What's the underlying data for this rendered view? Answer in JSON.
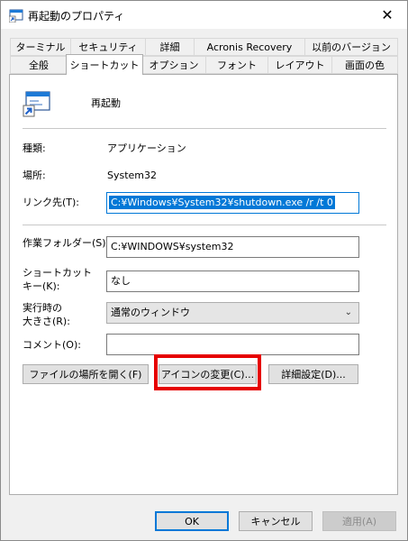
{
  "window": {
    "title": "再起動のプロパティ",
    "close_glyph": "✕"
  },
  "tabs": {
    "row1": [
      "ターミナル",
      "セキュリティ",
      "詳細",
      "Acronis Recovery",
      "以前のバージョン"
    ],
    "row2": [
      "全般",
      "ショートカット",
      "オプション",
      "フォント",
      "レイアウト",
      "画面の色"
    ],
    "active": "ショートカット"
  },
  "shortcut": {
    "name": "再起動",
    "type_label": "種類:",
    "type_value": "アプリケーション",
    "location_label": "場所:",
    "location_value": "System32",
    "target_label": "リンク先(T):",
    "target_value": "C:¥Windows¥System32¥shutdown.exe /r /t 0",
    "startin_label": "作業フォルダー(S):",
    "startin_value": "C:¥WINDOWS¥system32",
    "hotkey_label_1": "ショートカット",
    "hotkey_label_2": "キー(K):",
    "hotkey_value": "なし",
    "run_label_1": "実行時の",
    "run_label_2": "大きさ(R):",
    "run_value": "通常のウィンドウ",
    "comment_label": "コメント(O):",
    "comment_value": ""
  },
  "buttons": {
    "open_location": "ファイルの場所を開く(F)",
    "change_icon": "アイコンの変更(C)...",
    "advanced": "詳細設定(D)...",
    "ok": "OK",
    "cancel": "キャンセル",
    "apply": "適用(A)"
  },
  "colors": {
    "selection": "#0078d7",
    "highlight_box": "#e60000"
  },
  "icons": {
    "title": "shortcut-window-icon",
    "shortcut": "shortcut-app-icon",
    "close": "close-icon",
    "dropdown": "chevron-down-icon"
  }
}
